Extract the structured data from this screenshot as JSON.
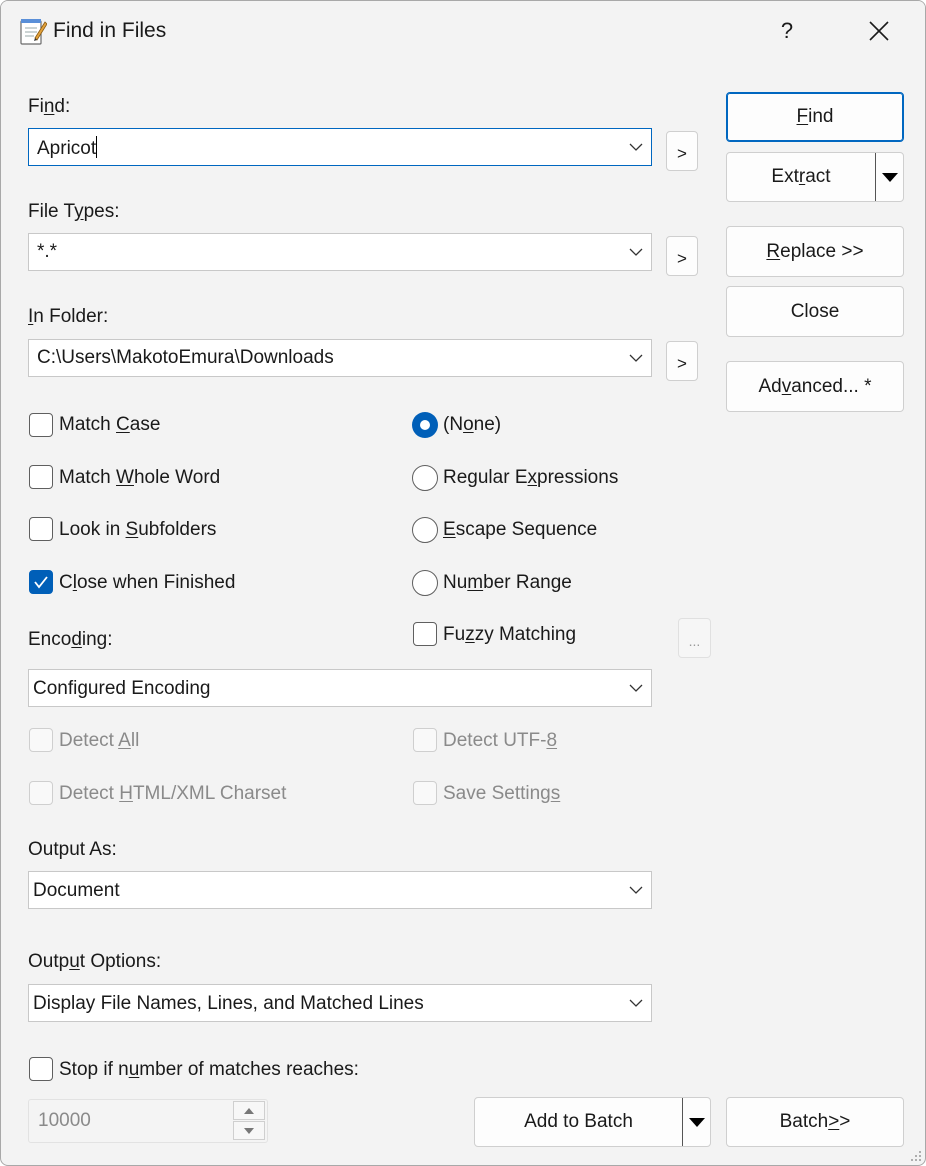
{
  "window": {
    "title": "Find in Files",
    "help_label": "?"
  },
  "find": {
    "label_pre": "Fi",
    "label_u": "n",
    "label_post": "d:",
    "value": "Apricot",
    "more_label": ">"
  },
  "file_types": {
    "label_pre": "File T",
    "label_u": "y",
    "label_post": "pes:",
    "value": "*.*",
    "more_label": ">"
  },
  "in_folder": {
    "label_pre": "",
    "label_u": "I",
    "label_post": "n Folder:",
    "value": "C:\\Users\\MakotoEmura\\Downloads",
    "more_label": ">"
  },
  "buttons": {
    "find": {
      "pre": "",
      "u": "F",
      "post": "ind"
    },
    "extract": {
      "pre": "Ext",
      "u": "r",
      "post": "act"
    },
    "replace": {
      "pre": "",
      "u": "R",
      "post": "eplace >>"
    },
    "close": "Close",
    "advanced": {
      "pre": "Ad",
      "u": "v",
      "post": "anced... *"
    },
    "add_to_batch": "Add to Batch",
    "batch": {
      "pre": "Batch ",
      "u": ">",
      "post": ">"
    }
  },
  "checkboxes": {
    "match_case": {
      "pre": "Match ",
      "u": "C",
      "post": "ase",
      "checked": false
    },
    "match_whole_word": {
      "pre": "Match ",
      "u": "W",
      "post": "hole Word",
      "checked": false
    },
    "look_in_subfolders": {
      "pre": "Look in ",
      "u": "S",
      "post": "ubfolders",
      "checked": false
    },
    "close_when_finished": {
      "pre": "C",
      "u": "l",
      "post": "ose when Finished",
      "checked": true
    },
    "fuzzy_matching": {
      "pre": "Fu",
      "u": "z",
      "post": "zy Matching",
      "checked": false
    },
    "fuzzy_options_label": "...",
    "detect_all": {
      "pre": "Detect ",
      "u": "A",
      "post": "ll"
    },
    "detect_utf8": {
      "pre": "Detect UTF-",
      "u": "8",
      "post": ""
    },
    "detect_html": {
      "pre": "Detect ",
      "u": "H",
      "post": "TML/XML Charset"
    },
    "save_settings": {
      "pre": "Save Setting",
      "u": "s",
      "post": ""
    },
    "stop_matches": {
      "pre": "Stop if n",
      "u": "u",
      "post": "mber of matches reaches:",
      "checked": false
    }
  },
  "radios": {
    "none": {
      "pre": "(N",
      "u": "o",
      "post": "ne)",
      "checked": true
    },
    "regex": {
      "pre": "Regular E",
      "u": "x",
      "post": "pressions"
    },
    "escape": {
      "pre": "",
      "u": "E",
      "post": "scape Sequence"
    },
    "number_range": {
      "pre": "Nu",
      "u": "m",
      "post": "ber Range"
    }
  },
  "encoding": {
    "label_pre": "Enco",
    "label_u": "d",
    "label_post": "ing:",
    "value": "Configured Encoding"
  },
  "output_as": {
    "label": "Output As:",
    "value": "Document"
  },
  "output_options": {
    "label_pre": "Outp",
    "label_u": "u",
    "label_post": "t Options:",
    "value": "Display File Names, Lines, and Matched Lines"
  },
  "stop_count": {
    "value": "10000"
  },
  "colors": {
    "accent": "#005fb8",
    "focus_border": "#0067c0",
    "window_bg": "#f3f3f3"
  }
}
